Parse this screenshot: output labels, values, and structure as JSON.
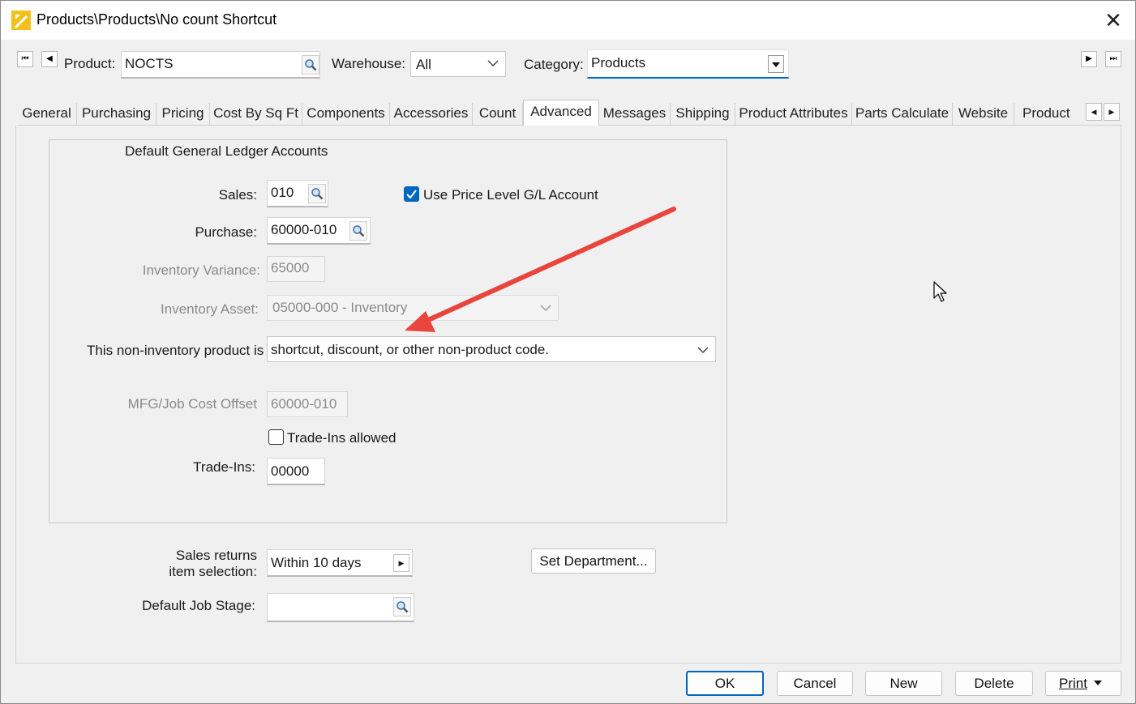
{
  "window": {
    "title": "Products\\Products\\No count Shortcut",
    "close_glyph": "✕"
  },
  "header": {
    "product_label": "Product:",
    "product_value": "NOCTS",
    "warehouse_label": "Warehouse:",
    "warehouse_value": "All",
    "category_label": "Category:",
    "category_value": "Products"
  },
  "tabs": [
    {
      "label": "General"
    },
    {
      "label": "Purchasing"
    },
    {
      "label": "Pricing"
    },
    {
      "label": "Cost By Sq Ft"
    },
    {
      "label": "Components"
    },
    {
      "label": "Accessories"
    },
    {
      "label": "Count"
    },
    {
      "label": "Advanced"
    },
    {
      "label": "Messages"
    },
    {
      "label": "Shipping"
    },
    {
      "label": "Product Attributes"
    },
    {
      "label": "Parts Calculate"
    },
    {
      "label": "Website"
    },
    {
      "label": "Product Sp"
    }
  ],
  "active_tab": "Advanced",
  "gl": {
    "group_title": "Default General Ledger Accounts",
    "sales_label": "Sales:",
    "sales_value": "010",
    "use_price_level_label": "Use Price Level G/L Account",
    "use_price_level_checked": true,
    "purchase_label": "Purchase:",
    "purchase_value": "60000-010",
    "inv_variance_label": "Inventory Variance:",
    "inv_variance_value": "65000",
    "inv_asset_label": "Inventory Asset:",
    "inv_asset_value": "05000-000 - Inventory",
    "noninv_label": "This non-inventory product is a",
    "noninv_value": "shortcut, discount, or other non-product code.",
    "mfg_label": "MFG/Job Cost Offset",
    "mfg_value": "60000-010",
    "tradeins_allowed_label": "Trade-Ins allowed",
    "tradeins_allowed_checked": false,
    "tradeins_label": "Trade-Ins:",
    "tradeins_value": "00000"
  },
  "lower": {
    "sales_returns_label_1": "Sales returns",
    "sales_returns_label_2": "item selection:",
    "sales_returns_value": "Within 10  days",
    "set_department_label": "Set Department...",
    "job_stage_label": "Default Job Stage:",
    "job_stage_value": ""
  },
  "footer": {
    "ok": "OK",
    "cancel": "Cancel",
    "new": "New",
    "delete": "Delete",
    "print": "Print"
  },
  "colors": {
    "accent": "#0067c0",
    "annotation_arrow": "#e8453c"
  }
}
